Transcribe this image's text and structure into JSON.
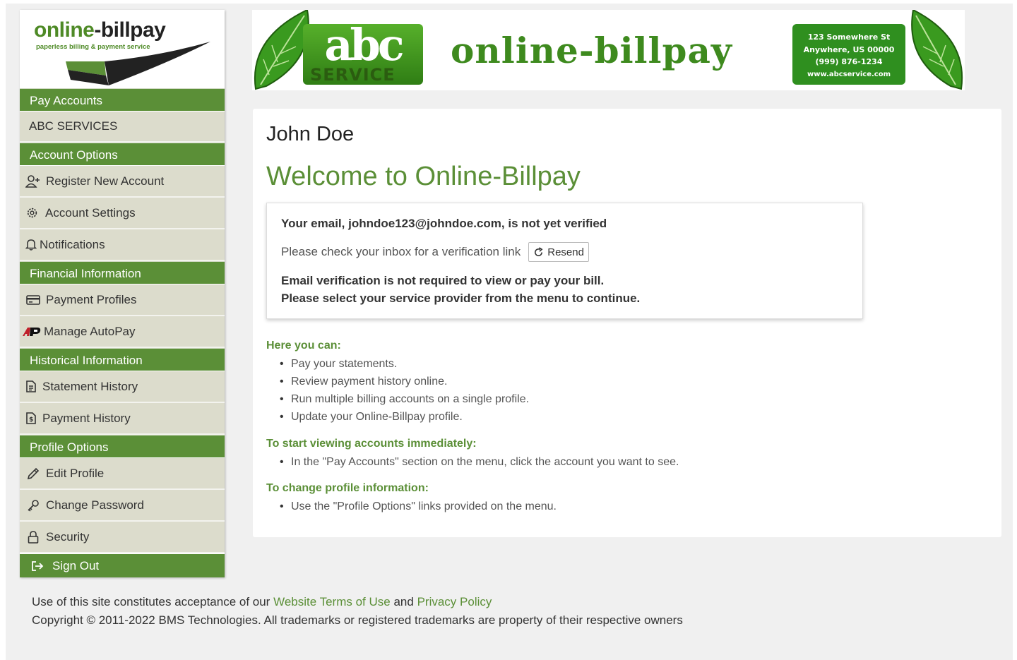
{
  "logo": {
    "brand_part1": "online",
    "brand_part2": "-billpay",
    "tagline": "paperless billing & payment service"
  },
  "banner": {
    "abc_letters": "abc",
    "abc_service": "SERVICE",
    "title": "online-billpay",
    "address_line1": "123 Somewhere St",
    "address_line2": "Anywhere, US 00000",
    "phone": "(999) 876-1234",
    "website": "www.abcservice.com"
  },
  "sidebar": {
    "sections": [
      {
        "heading": "Pay Accounts",
        "items": [
          {
            "label": "ABC SERVICES",
            "icon": "none"
          }
        ]
      },
      {
        "heading": "Account Options",
        "items": [
          {
            "label": "Register New Account",
            "icon": "user-add-icon"
          },
          {
            "label": "Account Settings",
            "icon": "gear-icon"
          },
          {
            "label": "Notifications",
            "icon": "bell-icon"
          }
        ]
      },
      {
        "heading": "Financial Information",
        "items": [
          {
            "label": "Payment Profiles",
            "icon": "credit-card-icon"
          },
          {
            "label": "Manage AutoPay",
            "icon": "autopay-icon"
          }
        ]
      },
      {
        "heading": "Historical Information",
        "items": [
          {
            "label": "Statement History",
            "icon": "document-icon"
          },
          {
            "label": "Payment History",
            "icon": "receipt-icon"
          }
        ]
      },
      {
        "heading": "Profile Options",
        "items": [
          {
            "label": "Edit Profile",
            "icon": "pencil-icon"
          },
          {
            "label": "Change Password",
            "icon": "key-icon"
          },
          {
            "label": "Security",
            "icon": "lock-icon"
          }
        ]
      }
    ],
    "sign_out": "Sign Out"
  },
  "main": {
    "user_name": "John Doe",
    "welcome": "Welcome to Online-Billpay",
    "verify": {
      "heading": "Your email, johndoe123@johndoe.com, is not yet verified",
      "check_text": "Please check your inbox for a verification link",
      "resend_label": "Resend",
      "note_line1": "Email verification is not required to view or pay your bill.",
      "note_line2": "Please select your service provider from the menu to continue."
    },
    "here_you_can": {
      "title": "Here you can:",
      "items": [
        "Pay your statements.",
        "Review payment history online.",
        "Run multiple billing accounts on a single profile.",
        "Update your Online-Billpay profile."
      ]
    },
    "start_viewing": {
      "title": "To start viewing accounts immediately:",
      "items": [
        "In the \"Pay Accounts\" section on the menu, click the account you want to see."
      ]
    },
    "change_profile": {
      "title": "To change profile information:",
      "items": [
        "Use the \"Profile Options\" links provided on the menu."
      ]
    }
  },
  "footer": {
    "prefix": "Use of this site constitutes acceptance of our",
    "terms_link": "Website Terms of Use",
    "and": "and",
    "privacy_link": "Privacy Policy",
    "copyright": "Copyright © 2011-2022 BMS Technologies. All trademarks or registered trademarks are property of their respective owners"
  },
  "colors": {
    "accent_green": "#5b8f37",
    "menu_bg": "#dcdccc",
    "page_bg": "#f0f0f0"
  }
}
